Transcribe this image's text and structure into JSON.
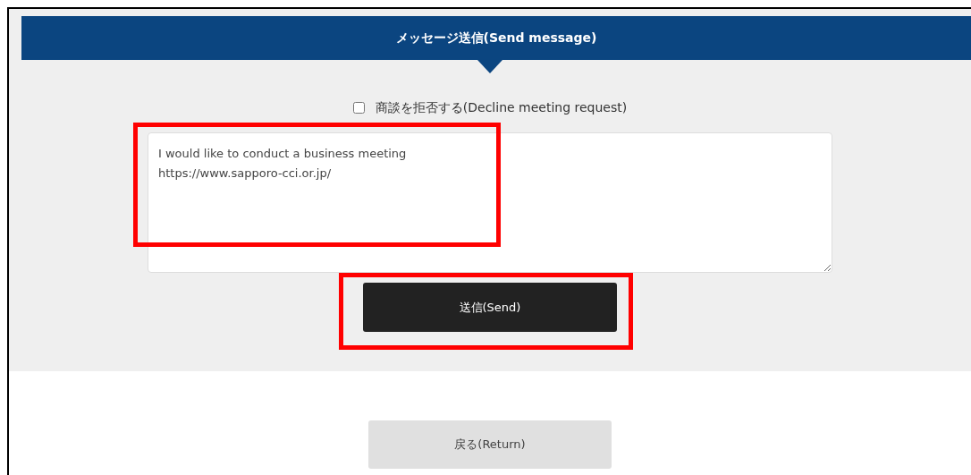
{
  "header": {
    "title": "メッセージ送信(Send message)"
  },
  "decline_checkbox": {
    "label": "商談を拒否する(Decline meeting request)",
    "checked": false
  },
  "message_field": {
    "value": "I would like to conduct a business meeting\nhttps://www.sapporo-cci.or.jp/",
    "highlighted": true
  },
  "send_button": {
    "label": "送信(Send)",
    "highlighted": true
  },
  "return_button": {
    "label": "戻る(Return)"
  }
}
